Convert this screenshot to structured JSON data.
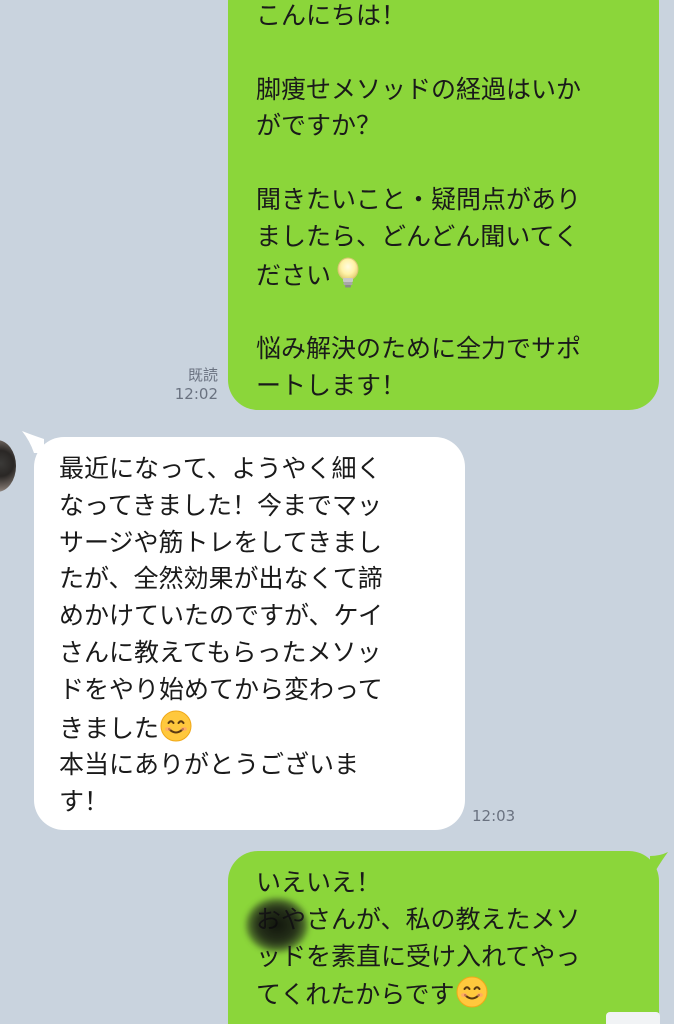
{
  "colors": {
    "background": "#c9d3de",
    "outgoing_bubble": "#8bd63a",
    "incoming_bubble": "#ffffff",
    "meta_text": "#6a7280"
  },
  "messages": [
    {
      "direction": "outgoing",
      "text": "こんにちは！\n\n脚痩せメソッドの経過はいか\nがですか？\n\n聞きたいこと・疑問点があり\nましたら、どんどん聞いてく\nださい",
      "emoji_after_text": "lightbulb-icon",
      "text2": "\n\n悩み解決のために全力でサポ\nートします！",
      "read_label": "既読",
      "time": "12:02"
    },
    {
      "direction": "incoming",
      "text": "最近になって、ようやく細く\nなってきました！今までマッ\nサージや筋トレをしてきまし\nたが、全然効果が出なくて諦\nめかけていたのですが、ケイ\nさんに教えてもらったメソッ\nドをやり始めてから変わって\nきました",
      "emoji_after_text": "smiling-face-icon",
      "text2": "\n本当にありがとうございま\nす！",
      "time": "12:03"
    },
    {
      "direction": "outgoing",
      "text": "いえいえ！\nおやさんが、私の教えたメソ\nッドを素直に受け入れてやっ\nてくれたからです",
      "emoji_after_text": "smiling-face-icon"
    }
  ]
}
